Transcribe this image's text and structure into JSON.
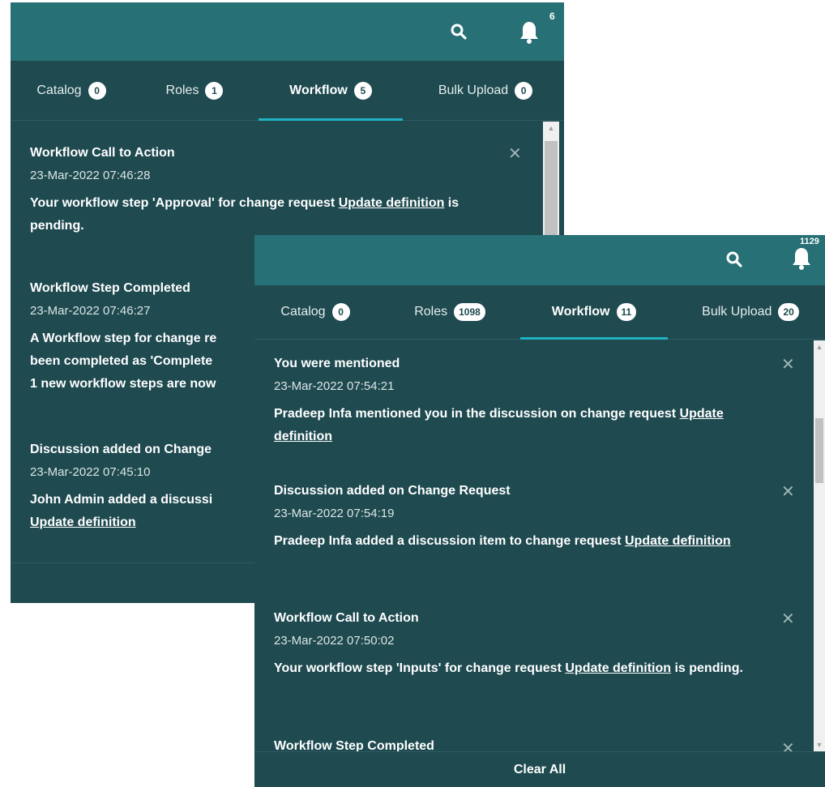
{
  "back": {
    "bell_count": "6",
    "tabs": [
      {
        "label": "Catalog",
        "count": "0"
      },
      {
        "label": "Roles",
        "count": "1"
      },
      {
        "label": "Workflow",
        "count": "5"
      },
      {
        "label": "Bulk Upload",
        "count": "0"
      }
    ],
    "notifications": [
      {
        "title": "Workflow Call to Action",
        "time": "23-Mar-2022 07:46:28",
        "msg_pre": "Your workflow step 'Approval' for change request ",
        "link": "Update definition",
        "msg_post": " is pending."
      },
      {
        "title": "Workflow Step Completed",
        "time": "23-Mar-2022 07:46:27",
        "line1": "A Workflow step for change re",
        "line2": "been completed as 'Complete",
        "line3": "1 new workflow steps are now"
      },
      {
        "title": "Discussion added on Change",
        "time": "23-Mar-2022 07:45:10",
        "msg_pre": "John Admin added a discussi",
        "link": "Update definition"
      }
    ]
  },
  "front": {
    "bell_count": "1129",
    "tabs": [
      {
        "label": "Catalog",
        "count": "0"
      },
      {
        "label": "Roles",
        "count": "1098"
      },
      {
        "label": "Workflow",
        "count": "11"
      },
      {
        "label": "Bulk Upload",
        "count": "20"
      }
    ],
    "notifications": [
      {
        "title": "You were mentioned",
        "time": "23-Mar-2022 07:54:21",
        "msg_pre": "Pradeep Infa mentioned you in the discussion on change request ",
        "link": "Update definition",
        "msg_post": ""
      },
      {
        "title": "Discussion added on Change Request",
        "time": "23-Mar-2022 07:54:19",
        "msg_pre": "Pradeep Infa added a discussion item to change request ",
        "link": "Update definition",
        "msg_post": ""
      },
      {
        "title": "Workflow Call to Action",
        "time": "23-Mar-2022 07:50:02",
        "msg_pre": "Your workflow step 'Inputs' for change request ",
        "link": "Update definition",
        "msg_post": " is pending."
      },
      {
        "title": "Workflow Step Completed"
      }
    ],
    "clear_all": "Clear All"
  }
}
